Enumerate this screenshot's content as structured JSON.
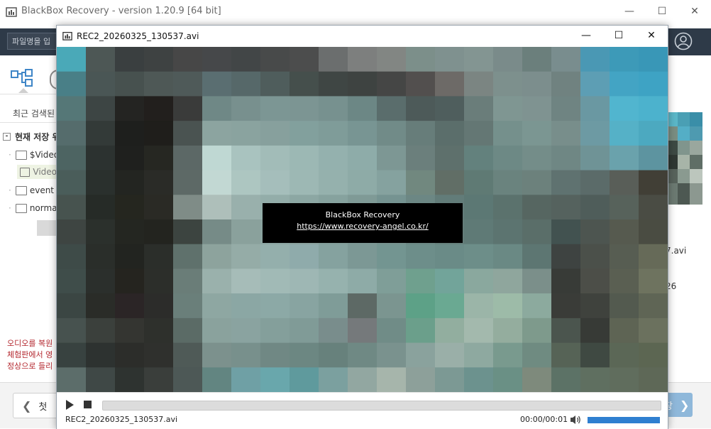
{
  "main_window": {
    "title": "BlackBox Recovery - version 1.20.9 [64 bit]",
    "search_placeholder": "파일명을 입",
    "recent_search_label": "최근 검색된",
    "tree_root_label": "현재 저장 위",
    "tree_items": [
      "$Video",
      "Video",
      "event",
      "normal"
    ],
    "notice_lines": [
      "오디오를 복원",
      "체험판에서 영",
      "정상으로 들리"
    ],
    "nav_first_label": "첫",
    "right_file_fragment": "7.avi",
    "right_number_fragment": "26",
    "next_label": "장"
  },
  "player": {
    "title": "REC2_20260325_130537.avi",
    "overlay_line1": "BlackBox Recovery",
    "overlay_link": "https://www.recovery-angel.co.kr/",
    "filename": "REC2_20260325_130537.avi",
    "time": "00:00/00:01",
    "volume_level": 1.0
  },
  "colors": {
    "toolbar_bg": "#2e3a48",
    "accent": "#2f7fd0",
    "notice_text": "#b3262d"
  }
}
